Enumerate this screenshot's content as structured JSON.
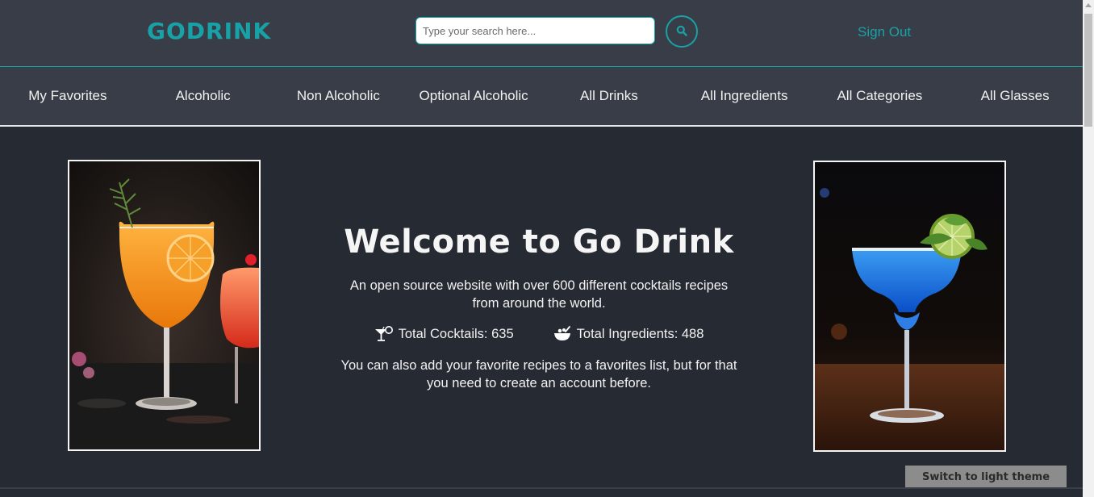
{
  "header": {
    "logo": "GODRINK",
    "search_placeholder": "Type your search here...",
    "search_icon": "magnifier-icon",
    "sign_out": "Sign Out"
  },
  "nav": {
    "items": [
      {
        "label": "My Favorites"
      },
      {
        "label": "Alcoholic"
      },
      {
        "label": "Non Alcoholic"
      },
      {
        "label": "Optional Alcoholic"
      },
      {
        "label": "All Drinks"
      },
      {
        "label": "All Ingredients"
      },
      {
        "label": "All Categories"
      },
      {
        "label": "All Glasses"
      }
    ]
  },
  "main": {
    "title": "Welcome to Go Drink",
    "intro": "An open source website with over 600 different cocktails recipes from around the world.",
    "stats": {
      "cocktails_label": "Total Cocktails: 635",
      "cocktails_icon": "cocktail-glass-icon",
      "ingredients_label": "Total Ingredients: 488",
      "ingredients_icon": "mixing-bowl-icon"
    },
    "note": "You can also add your favorite recipes to a favorites list, but for that you need to create an account before.",
    "images": [
      {
        "name": "orange-cocktail-photo",
        "description_icon": "orange-cocktail"
      },
      {
        "name": "blue-margarita-photo",
        "description_icon": "blue-margarita"
      }
    ]
  },
  "theme_button": "Switch to light theme",
  "colors": {
    "accent": "#17a2a8",
    "header_bg": "#393d47",
    "page_bg": "#262a33",
    "theme_button_bg": "#8c8c8c"
  }
}
